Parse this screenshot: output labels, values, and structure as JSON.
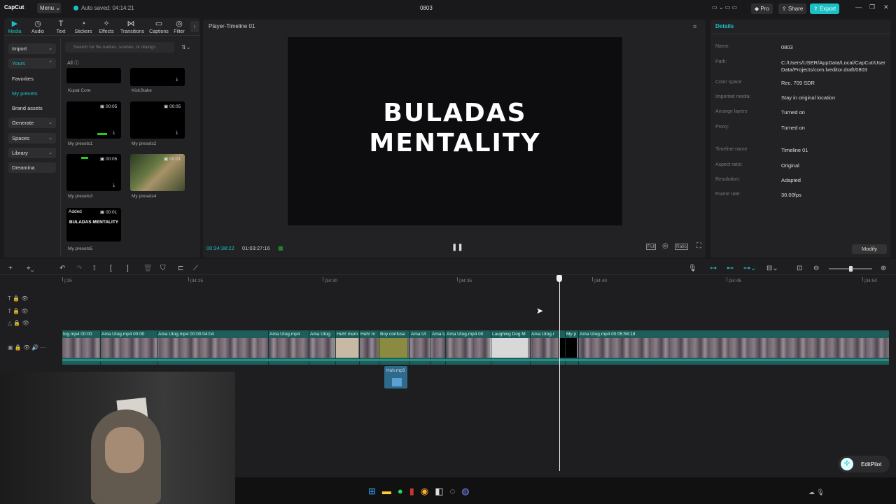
{
  "app": {
    "logo": "CapCut",
    "menu": "Menu",
    "autosave": "Auto saved: 04:14:21",
    "project_title": "0803",
    "pro": "Pro",
    "share": "Share",
    "export": "Export"
  },
  "toolbar": [
    {
      "label": "Media",
      "icon": "media-icon"
    },
    {
      "label": "Audio",
      "icon": "audio-icon"
    },
    {
      "label": "Text",
      "icon": "text-icon"
    },
    {
      "label": "Stickers",
      "icon": "stickers-icon"
    },
    {
      "label": "Effects",
      "icon": "effects-icon"
    },
    {
      "label": "Transitions",
      "icon": "transitions-icon"
    },
    {
      "label": "Captions",
      "icon": "captions-icon"
    },
    {
      "label": "Filter",
      "icon": "filter-icon"
    }
  ],
  "leftnav": {
    "import": "Import",
    "yours": "Yours",
    "favorites": "Favorites",
    "my_presets": "My presets",
    "brand_assets": "Brand assets",
    "generate": "Generate",
    "spaces": "Spaces",
    "library": "Library",
    "dreamina": "Dreamina"
  },
  "media": {
    "search_placeholder": "Search for file names, scenes, or dialogs",
    "filter_all": "All",
    "items": [
      {
        "label": "Kupal Core"
      },
      {
        "label": "KickStake"
      },
      {
        "label": "My presets1",
        "duration": "00:05"
      },
      {
        "label": "My presets2",
        "duration": "00:05"
      },
      {
        "label": "My presets3",
        "duration": "00:05"
      },
      {
        "label": "My presets4",
        "duration": "00:01"
      },
      {
        "label": "My presets5",
        "duration": "00:01",
        "badge": "Added",
        "thumb_text": "BULADAS MENTALITY"
      }
    ]
  },
  "player": {
    "title": "Player-Timeline 01",
    "video_line1": "BULADAS",
    "video_line2": "MENTALITY",
    "current_time": "00:34:38:22",
    "total_time": "01:03:27:16",
    "full": "Full",
    "ratio": "Ratio"
  },
  "details": {
    "title": "Details",
    "rows": [
      {
        "k": "Name:",
        "v": "0803"
      },
      {
        "k": "Path:",
        "v": "C:/Users/USER/AppData/Local/CapCut/User Data/Projects/com.lveditor.draft/0803"
      },
      {
        "k": "Color space",
        "v": "Rec. 709 SDR"
      },
      {
        "k": "Imported media:",
        "v": "Stay in original location"
      },
      {
        "k": "Arrange layers",
        "v": "Turned on"
      },
      {
        "k": "Proxy:",
        "v": "Turned on"
      },
      {
        "k": "Timeline name",
        "v": "Timeline 01"
      },
      {
        "k": "Aspect ratio:",
        "v": "Original"
      },
      {
        "k": "Resolution:",
        "v": "Adapted"
      },
      {
        "k": "Frame rate:",
        "v": "30.00fps"
      }
    ],
    "modify": "Modify"
  },
  "timeline": {
    "ticks": [
      "|:25",
      "|34:25",
      "|34:30",
      "|34:35",
      "|34:40",
      "|34:45",
      "|34:50"
    ],
    "clips": [
      {
        "label": "tog.mp4  00:00"
      },
      {
        "label": "Ama Utog.mp4  00:00"
      },
      {
        "label": "Ama Utog.mp4  00:00:04:04"
      },
      {
        "label": "Ama Utog.mp4"
      },
      {
        "label": "Ama Utog"
      },
      {
        "label": "Huh! mem"
      },
      {
        "label": "Huh! m"
      },
      {
        "label": "Boy confuse"
      },
      {
        "label": "Ama Ut"
      },
      {
        "label": "Ama U"
      },
      {
        "label": "Ama Utog.mp4  00"
      },
      {
        "label": "Laughing Dog M"
      },
      {
        "label": "Ama Utog.r"
      },
      {
        "label": "My p"
      },
      {
        "label": "Ama Utog.mp4  00:05:58:18"
      }
    ],
    "audio_clip": "Huh.mp3"
  },
  "editpilot": "EditPilot"
}
